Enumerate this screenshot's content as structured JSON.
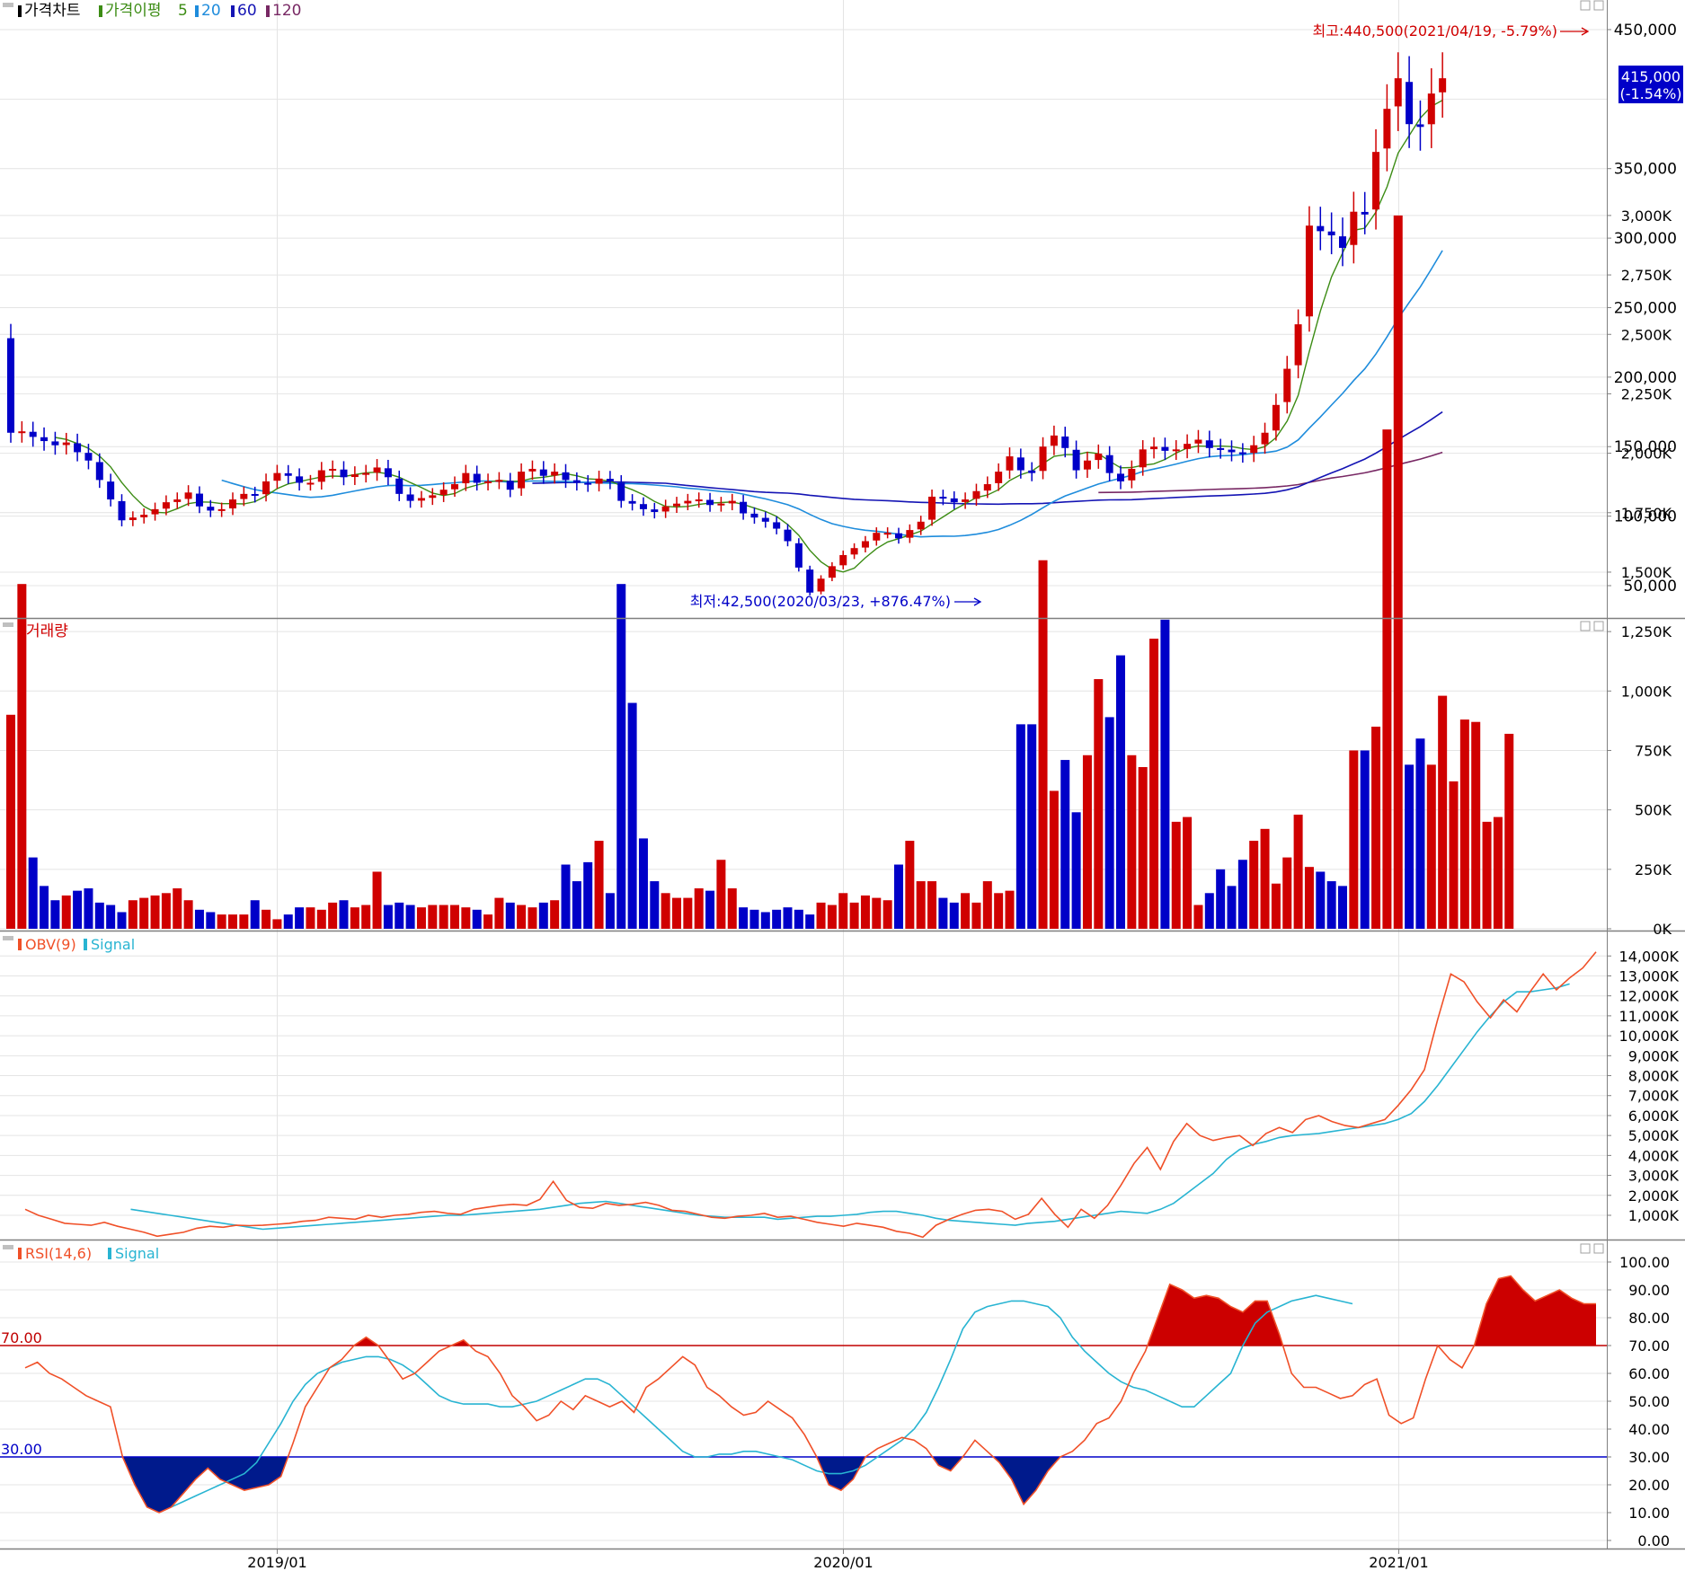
{
  "panels": {
    "price": {
      "title": "가격차트",
      "ma_label": "가격이평",
      "ma_periods": [
        "5",
        "20",
        "60",
        "120"
      ]
    },
    "volume": {
      "title": "거래량"
    },
    "obv": {
      "title": "OBV(9)",
      "signal": "Signal"
    },
    "rsi": {
      "title": "RSI(14,6)",
      "signal": "Signal",
      "upper_line_label": "70.00",
      "lower_line_label": "30.00"
    }
  },
  "annotations": {
    "high": "최고:440,500(2021/04/19, -5.79%)",
    "low": "최저:42,500(2020/03/23, +876.47%)",
    "current_price": "415,000",
    "current_change": "(-1.54%)"
  },
  "colors": {
    "up": "#d00000",
    "down": "#0000c8",
    "ma5": "#3c8c14",
    "ma20": "#1e8cdc",
    "ma60": "#1414b4",
    "ma120": "#782864",
    "obv": "#f05028",
    "obv_signal": "#28b4d2",
    "rsi_high": "#cc0000",
    "rsi_low": "#001a8c"
  },
  "x_axis": {
    "ticks": [
      "2019/01",
      "2020/01",
      "2021/01"
    ],
    "tick_index": [
      24,
      75,
      125
    ]
  },
  "y_axis": {
    "price_ticks": [
      "450,000",
      "350,000",
      "300,000",
      "250,000",
      "200,000",
      "150,000",
      "100,000",
      "50,000"
    ],
    "price_tick_values": [
      450000,
      350000,
      300000,
      250000,
      200000,
      150000,
      100000,
      50000
    ],
    "volume_ticks": [
      "3,000K",
      "2,750K",
      "2,500K",
      "2,250K",
      "2,000K",
      "1,750K",
      "1,500K",
      "1,250K",
      "1,000K",
      "750K",
      "500K",
      "250K",
      "0K"
    ],
    "volume_tick_values": [
      3000,
      2750,
      2500,
      2250,
      2000,
      1750,
      1500,
      1250,
      1000,
      750,
      500,
      250,
      0
    ],
    "obv_ticks": [
      "14,000K",
      "13,000K",
      "12,000K",
      "11,000K",
      "10,000K",
      "9,000K",
      "8,000K",
      "7,000K",
      "6,000K",
      "5,000K",
      "4,000K",
      "3,000K",
      "2,000K",
      "1,000K"
    ],
    "obv_tick_values": [
      14000,
      13000,
      12000,
      11000,
      10000,
      9000,
      8000,
      7000,
      6000,
      5000,
      4000,
      3000,
      2000,
      1000
    ],
    "rsi_ticks": [
      "100.00",
      "90.00",
      "80.00",
      "70.00",
      "60.00",
      "50.00",
      "40.00",
      "30.00",
      "20.00",
      "10.00",
      "0.00"
    ],
    "rsi_tick_values": [
      100,
      90,
      80,
      70,
      60,
      50,
      40,
      30,
      20,
      10,
      0
    ]
  },
  "chart_data": {
    "type": "candlestick",
    "period": "weekly",
    "close": [
      160000,
      161000,
      157000,
      154000,
      151000,
      153000,
      146000,
      140000,
      126000,
      112000,
      97000,
      99000,
      101000,
      105000,
      110000,
      112000,
      117000,
      107000,
      104000,
      105000,
      112000,
      116000,
      115000,
      125000,
      131000,
      129000,
      124000,
      124000,
      133000,
      134000,
      128000,
      130000,
      131000,
      135000,
      128000,
      116000,
      111000,
      113000,
      115000,
      119000,
      123000,
      131000,
      124000,
      125000,
      126000,
      119000,
      132000,
      134000,
      129000,
      132000,
      126000,
      124000,
      123000,
      127000,
      125000,
      111000,
      109000,
      105000,
      103000,
      107000,
      109000,
      111000,
      112000,
      108000,
      109000,
      111000,
      102000,
      99000,
      96000,
      91000,
      82000,
      63000,
      45000,
      55000,
      64000,
      72000,
      77000,
      82000,
      88000,
      88000,
      84000,
      90000,
      96000,
      114000,
      113000,
      110000,
      112000,
      118000,
      123000,
      132000,
      143000,
      133000,
      131000,
      150000,
      158000,
      149000,
      133000,
      140000,
      145000,
      131000,
      125000,
      134000,
      148000,
      150000,
      147000,
      148000,
      152000,
      155000,
      149000,
      148000,
      146000,
      145000,
      151000,
      160000,
      180000,
      206000,
      238000,
      309000,
      305000,
      302000,
      293000,
      319000,
      317000,
      362000,
      393000,
      415000,
      382000,
      380000,
      404000,
      415000
    ],
    "ma5_start_index": 2,
    "ma20_start_index": 19,
    "ma60_start_index": 59,
    "ma120_start_index": 119,
    "volume": [
      900,
      1450,
      300,
      180,
      120,
      140,
      160,
      170,
      110,
      100,
      70,
      120,
      130,
      140,
      150,
      170,
      120,
      80,
      70,
      60,
      60,
      60,
      120,
      80,
      40,
      60,
      90,
      90,
      80,
      110,
      120,
      90,
      100,
      240,
      100,
      110,
      100,
      90,
      100,
      100,
      100,
      90,
      80,
      60,
      130,
      110,
      100,
      90,
      110,
      120,
      270,
      200,
      280,
      370,
      150,
      1450,
      950,
      380,
      200,
      150,
      130,
      130,
      170,
      160,
      290,
      170,
      90,
      80,
      70,
      80,
      90,
      80,
      60,
      110,
      100,
      150,
      110,
      140,
      130,
      120,
      270,
      370,
      200,
      200,
      130,
      110,
      150,
      110,
      200,
      150,
      160,
      860,
      860,
      1550,
      580,
      710,
      490,
      730,
      1050,
      890,
      1150,
      730,
      680,
      1220,
      1300,
      450,
      470,
      100,
      150,
      250,
      180,
      290,
      370,
      420,
      190,
      300,
      480,
      260,
      240,
      200,
      180,
      750,
      750,
      850,
      2100,
      3000,
      690,
      800,
      690,
      980,
      620,
      880,
      870,
      450,
      470,
      820
    ],
    "obv": [
      1300,
      1000,
      800,
      600,
      550,
      500,
      650,
      450,
      300,
      150,
      -50,
      50,
      150,
      350,
      450,
      400,
      500,
      480,
      500,
      550,
      600,
      700,
      750,
      900,
      850,
      800,
      1000,
      900,
      1000,
      1050,
      1150,
      1200,
      1100,
      1050,
      1300,
      1400,
      1500,
      1550,
      1500,
      1800,
      2700,
      1750,
      1400,
      1350,
      1600,
      1500,
      1550,
      1650,
      1500,
      1250,
      1200,
      1050,
      900,
      850,
      950,
      1000,
      1100,
      900,
      950,
      800,
      650,
      550,
      450,
      600,
      500,
      400,
      200,
      100,
      -100,
      500,
      800,
      1050,
      1250,
      1300,
      1200,
      800,
      1050,
      1850,
      1050,
      400,
      1300,
      850,
      1500,
      2500,
      3600,
      4400,
      3300,
      4700,
      5600,
      5000,
      4750,
      4900,
      5000,
      4500,
      5100,
      5400,
      5150,
      5800,
      6000,
      5700,
      5500,
      5400,
      5600,
      5800,
      6500,
      7300,
      8300,
      10800,
      13100,
      12700,
      11700,
      10900,
      11800,
      11200,
      12200,
      13100,
      12300,
      12900,
      13400,
      14200
    ],
    "obv_signal_start_index": 8,
    "obv_signal": [
      1300,
      1200,
      1100,
      1000,
      900,
      800,
      700,
      600,
      500,
      400,
      300,
      350,
      400,
      450,
      500,
      550,
      600,
      650,
      700,
      750,
      800,
      850,
      900,
      950,
      1000,
      1000,
      1050,
      1100,
      1150,
      1200,
      1250,
      1300,
      1400,
      1500,
      1600,
      1650,
      1700,
      1600,
      1500,
      1400,
      1300,
      1200,
      1100,
      1000,
      950,
      900,
      900,
      900,
      900,
      800,
      850,
      900,
      950,
      950,
      1000,
      1050,
      1150,
      1200,
      1200,
      1100,
      1000,
      850,
      750,
      700,
      650,
      600,
      550,
      500,
      600,
      650,
      700,
      800,
      900,
      1000,
      1100,
      1200,
      1150,
      1100,
      1300,
      1600,
      2100,
      2600,
      3100,
      3800,
      4300,
      4550,
      4700,
      4900,
      5000,
      5050,
      5100,
      5200,
      5300,
      5400,
      5500,
      5600,
      5800,
      6100,
      6700,
      7500,
      8400,
      9300,
      10200,
      11000,
      11700,
      12200,
      12200,
      12300,
      12400,
      12600
    ],
    "rsi": [
      62,
      64,
      60,
      58,
      55,
      52,
      50,
      48,
      30,
      20,
      12,
      10,
      12,
      17,
      22,
      26,
      22,
      20,
      18,
      19,
      20,
      23,
      35,
      48,
      55,
      62,
      65,
      70,
      73,
      70,
      64,
      58,
      60,
      64,
      68,
      70,
      72,
      68,
      66,
      60,
      52,
      48,
      43,
      45,
      50,
      47,
      52,
      50,
      48,
      50,
      46,
      55,
      58,
      62,
      66,
      63,
      55,
      52,
      48,
      45,
      46,
      50,
      47,
      44,
      38,
      30,
      20,
      18,
      22,
      30,
      33,
      35,
      37,
      36,
      33,
      27,
      25,
      30,
      36,
      32,
      28,
      22,
      13,
      18,
      25,
      30,
      32,
      36,
      42,
      44,
      50,
      60,
      68,
      80,
      92,
      90,
      87,
      88,
      87,
      84,
      82,
      86,
      86,
      74,
      60,
      55,
      55,
      53,
      51,
      52,
      56,
      58,
      45,
      42,
      44,
      58,
      70,
      65,
      62,
      70,
      85,
      94,
      95,
      90,
      86,
      88,
      90,
      87,
      85,
      85
    ],
    "rsi_signal_start_index": 12,
    "rsi_signal": [
      12,
      14,
      16,
      18,
      20,
      22,
      24,
      28,
      35,
      42,
      50,
      56,
      60,
      62,
      64,
      65,
      66,
      66,
      65,
      63,
      60,
      56,
      52,
      50,
      49,
      49,
      49,
      48,
      48,
      49,
      50,
      52,
      54,
      56,
      58,
      58,
      56,
      52,
      48,
      44,
      40,
      36,
      32,
      30,
      30,
      31,
      31,
      32,
      32,
      31,
      30,
      29,
      27,
      25,
      24,
      24,
      25,
      27,
      30,
      33,
      36,
      40,
      46,
      55,
      65,
      76,
      82,
      84,
      85,
      86,
      86,
      85,
      84,
      80,
      73,
      68,
      64,
      60,
      57,
      55,
      54,
      52,
      50,
      48,
      48,
      52,
      56,
      60,
      70,
      78,
      82,
      84,
      86,
      87,
      88,
      87,
      86,
      85
    ]
  }
}
